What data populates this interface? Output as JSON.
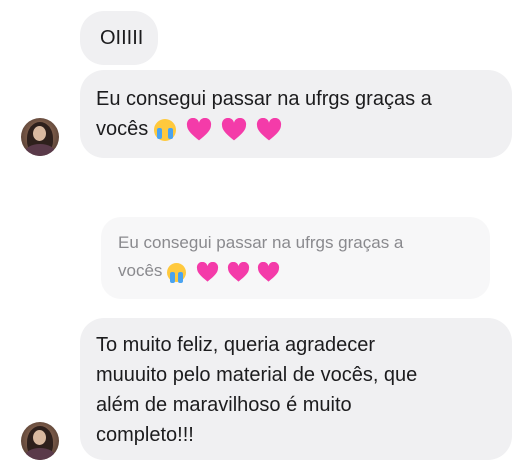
{
  "messages": [
    {
      "text": "OIIIII"
    },
    {
      "text_line1": "Eu consegui passar na ufrgs graças a",
      "text_line2": "vocês"
    },
    {
      "text_line1": "To muito feliz, queria agradecer",
      "text_line2": "muuuito pelo material de vocês, que",
      "text_line3": "além de maravilhoso é muito",
      "text_line4": "completo!!!"
    }
  ],
  "reply_quote": {
    "text_line1": "Eu consegui passar na ufrgs graças a",
    "text_line2": "vocês"
  },
  "emoji_sequence": [
    "crying-face",
    "pink-heart",
    "pink-heart",
    "pink-heart"
  ],
  "colors": {
    "bubble": "#f0f0f2",
    "quote_bubble": "#f7f7f8",
    "heart": "#f43ba9",
    "text": "#1c1c1e",
    "quote_text": "#8a8a8e"
  }
}
